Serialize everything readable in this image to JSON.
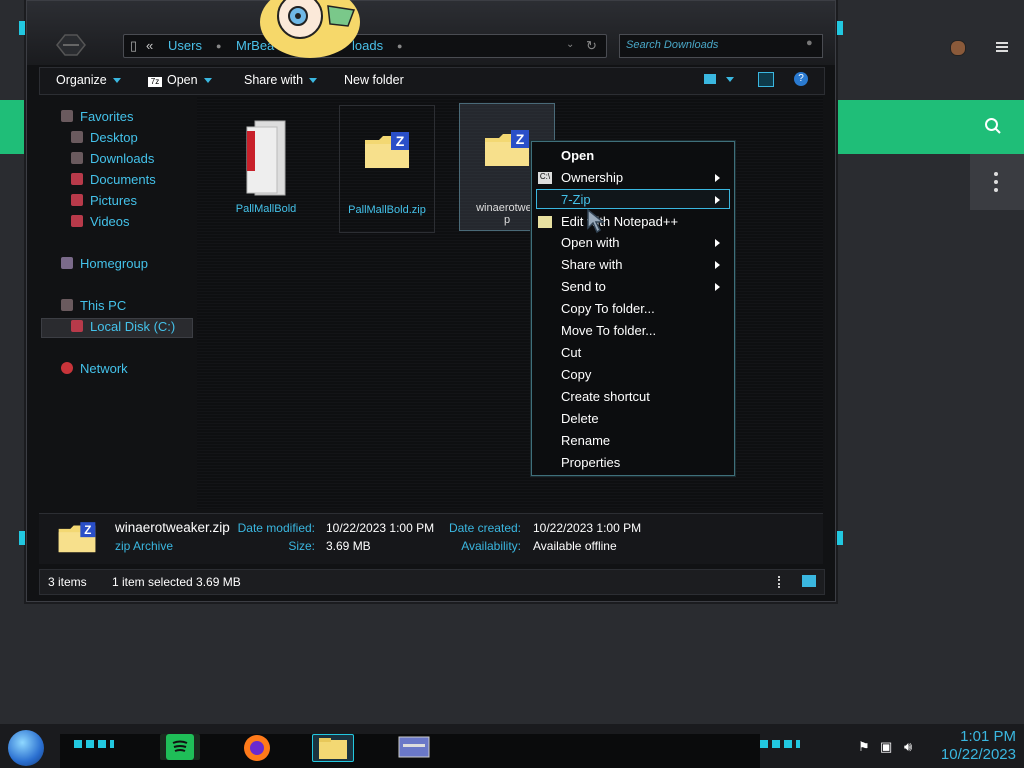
{
  "address": {
    "segments": [
      "Users",
      "MrBea",
      "loads"
    ]
  },
  "search": {
    "placeholder": "Search Downloads"
  },
  "toolbar": {
    "organize": "Organize",
    "open": "Open",
    "share_with": "Share with",
    "new_folder": "New folder"
  },
  "sidebar": {
    "favorites": "Favorites",
    "desktop": "Desktop",
    "downloads": "Downloads",
    "documents": "Documents",
    "pictures": "Pictures",
    "videos": "Videos",
    "homegroup": "Homegroup",
    "this_pc": "This PC",
    "local_disk": "Local Disk (C:)",
    "network": "Network"
  },
  "files": [
    {
      "name": "PallMallBold"
    },
    {
      "name": "PallMallBold.zip"
    },
    {
      "name": "winaerotwea",
      "name2": "p"
    }
  ],
  "context_menu": {
    "open": "Open",
    "ownership": "Ownership",
    "seven_zip": "7-Zip",
    "edit_notepad": "Edit with Notepad++",
    "open_with": "Open with",
    "share_with": "Share with",
    "send_to": "Send to",
    "copy_to_folder": "Copy To folder...",
    "move_to_folder": "Move To folder...",
    "cut": "Cut",
    "copy": "Copy",
    "create_shortcut": "Create shortcut",
    "delete": "Delete",
    "rename": "Rename",
    "properties": "Properties"
  },
  "details": {
    "filename": "winaerotweaker.zip",
    "type": "zip Archive",
    "date_modified_label": "Date modified:",
    "date_modified": "10/22/2023 1:00 PM",
    "size_label": "Size:",
    "size": "3.69 MB",
    "date_created_label": "Date created:",
    "date_created": "10/22/2023 1:00 PM",
    "availability_label": "Availability:",
    "availability": "Available offline"
  },
  "status": {
    "items": "3 items",
    "selected": "1 item selected  3.69 MB"
  },
  "clock": {
    "time": "1:01 PM",
    "date": "10/22/2023"
  },
  "colors": {
    "accent": "#3ab7e0",
    "green": "#1fbe78"
  }
}
